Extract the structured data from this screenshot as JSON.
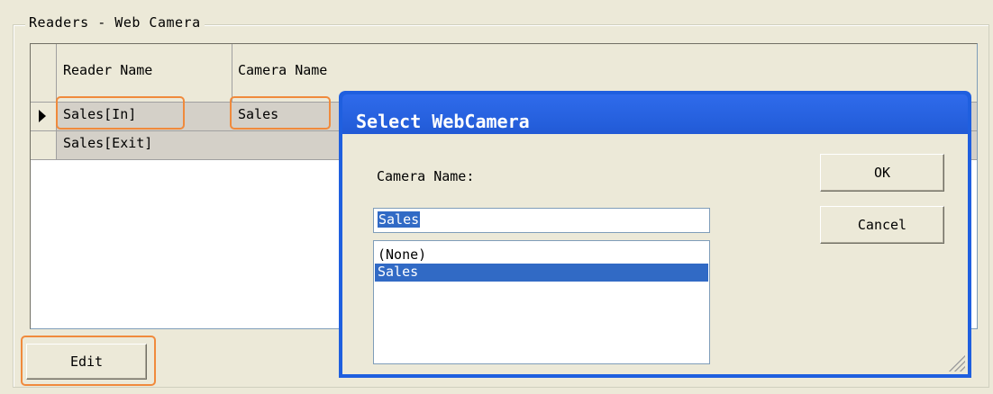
{
  "group": {
    "title": "Readers - Web Camera"
  },
  "grid": {
    "columns": [
      "Reader Name",
      "Camera Name"
    ],
    "rows": [
      {
        "reader": "Sales[In]",
        "camera": "Sales",
        "current": true
      },
      {
        "reader": "Sales[Exit]",
        "camera": "",
        "current": false
      }
    ]
  },
  "edit_button": {
    "label": "Edit"
  },
  "dialog": {
    "title": "Select WebCamera",
    "camera_label": "Camera Name:",
    "input_value": "Sales",
    "list_items": [
      "(None)",
      "Sales"
    ],
    "selected_item": "Sales",
    "ok_label": "OK",
    "cancel_label": "Cancel"
  },
  "colors": {
    "highlight": "#F08A3C",
    "selection": "#316AC5",
    "titlebar": "#245EDB"
  }
}
